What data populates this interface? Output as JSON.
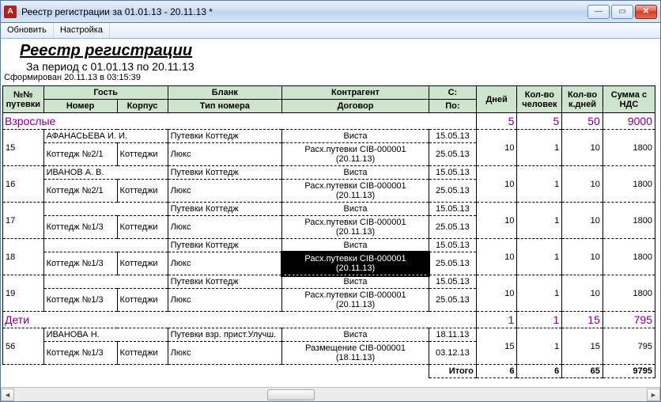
{
  "window": {
    "title": "Реестр регистрации за 01.01.13 - 20.11.13  *"
  },
  "menu": {
    "refresh": "Обновить",
    "settings": "Настройка"
  },
  "report": {
    "title": "Реестр регистрации",
    "period": "За период с 01.01.13 по 20.11.13",
    "generated": "Сформирован 20.11.13 в 03:15:39"
  },
  "headers": {
    "no": "№№\nпутевки",
    "guest": "Гость",
    "nomer": "Номер",
    "korpus": "Корпус",
    "blank": "Бланк",
    "tip": "Тип номера",
    "kontragent": "Контрагент",
    "dogovor": "Договор",
    "s": "С:",
    "po": "По:",
    "dney": "Дней",
    "ppl": "Кол-во\nчеловек",
    "kd": "Кол-во\nк.дней",
    "sum": "Сумма с\nНДС"
  },
  "sections": {
    "adults": {
      "label": "Взрослые",
      "dney": "5",
      "ppl": "5",
      "kd": "50",
      "sum": "9000"
    },
    "kids": {
      "label": "Дети",
      "dney": "1",
      "ppl": "1",
      "kd": "15",
      "sum": "795"
    }
  },
  "rows": {
    "r15": {
      "no": "15",
      "guest": "АФАНАСЬЕВА И. И.",
      "blank": "Путевки  Коттедж",
      "kontr": "Виста",
      "s": "15.05.13",
      "nomer": "Коттедж №2/1",
      "korp": "Коттеджи",
      "tip": "Люкс",
      "dog": "Расх.путевки CIB-000001 (20.11.13)",
      "po": "25.05.13",
      "dney": "10",
      "ppl": "1",
      "kd": "10",
      "sum": "1800"
    },
    "r16": {
      "no": "16",
      "guest": "ИВАНОВ А. В.",
      "blank": "Путевки  Коттедж",
      "kontr": "Виста",
      "s": "15.05.13",
      "nomer": "Коттедж №2/1",
      "korp": "Коттеджи",
      "tip": "Люкс",
      "dog": "Расх.путевки CIB-000001 (20.11.13)",
      "po": "25.05.13",
      "dney": "10",
      "ppl": "1",
      "kd": "10",
      "sum": "1800"
    },
    "r17": {
      "no": "17",
      "blank": "Путевки  Коттедж",
      "kontr": "Виста",
      "s": "15.05.13",
      "nomer": "Коттедж №1/3",
      "korp": "Коттеджи",
      "tip": "Люкс",
      "dog": "Расх.путевки CIB-000001 (20.11.13)",
      "po": "25.05.13",
      "dney": "10",
      "ppl": "1",
      "kd": "10",
      "sum": "1800"
    },
    "r18": {
      "no": "18",
      "blank": "Путевки  Коттедж",
      "kontr": "Виста",
      "s": "15.05.13",
      "nomer": "Коттедж №1/3",
      "korp": "Коттеджи",
      "tip": "Люкс",
      "dog": "Расх.путевки CIB-000001 (20.11.13)",
      "po": "25.05.13",
      "dney": "10",
      "ppl": "1",
      "kd": "10",
      "sum": "1800"
    },
    "r19": {
      "no": "19",
      "blank": "Путевки  Коттедж",
      "kontr": "Виста",
      "s": "15.05.13",
      "nomer": "Коттедж №1/3",
      "korp": "Коттеджи",
      "tip": "Люкс",
      "dog": "Расх.путевки CIB-000001 (20.11.13)",
      "po": "25.05.13",
      "dney": "10",
      "ppl": "1",
      "kd": "10",
      "sum": "1800"
    },
    "r56": {
      "no": "56",
      "guest": "ИВАНОВА Н.",
      "blank": "Путевки взр. прист.Улучш.",
      "kontr": "Виста",
      "s": "18.11.13",
      "nomer": "Коттедж №1/3",
      "korp": "Коттеджи",
      "tip": "Люкс",
      "dog": "Размещение CIB-000001 (18.11.13)",
      "po": "03.12.13",
      "dney": "15",
      "ppl": "1",
      "kd": "15",
      "sum": "795"
    }
  },
  "totals": {
    "label": "Итого",
    "dney": "6",
    "ppl": "6",
    "kd": "65",
    "sum": "9795"
  }
}
